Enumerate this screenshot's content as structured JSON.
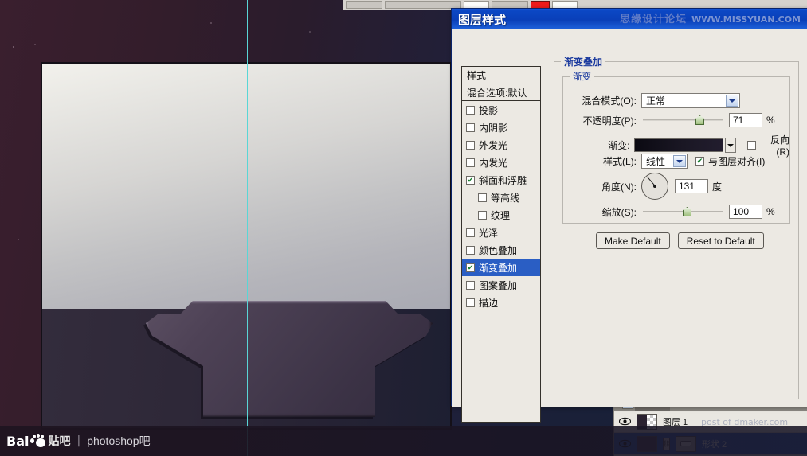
{
  "dialog": {
    "title": "图层样式",
    "styles_panel": {
      "header": "样式",
      "blending_options": "混合选项:默认",
      "items": [
        {
          "label": "投影",
          "checked": false,
          "indent": false,
          "active": false
        },
        {
          "label": "内阴影",
          "checked": false,
          "indent": false,
          "active": false
        },
        {
          "label": "外发光",
          "checked": false,
          "indent": false,
          "active": false
        },
        {
          "label": "内发光",
          "checked": false,
          "indent": false,
          "active": false
        },
        {
          "label": "斜面和浮雕",
          "checked": true,
          "indent": false,
          "active": false
        },
        {
          "label": "等高线",
          "checked": false,
          "indent": true,
          "active": false
        },
        {
          "label": "纹理",
          "checked": false,
          "indent": true,
          "active": false
        },
        {
          "label": "光泽",
          "checked": false,
          "indent": false,
          "active": false
        },
        {
          "label": "颜色叠加",
          "checked": false,
          "indent": false,
          "active": false
        },
        {
          "label": "渐变叠加",
          "checked": true,
          "indent": false,
          "active": true
        },
        {
          "label": "图案叠加",
          "checked": false,
          "indent": false,
          "active": false
        },
        {
          "label": "描边",
          "checked": false,
          "indent": false,
          "active": false
        }
      ]
    },
    "panel": {
      "group_title": "渐变叠加",
      "subgroup_title": "渐变",
      "blend_mode": {
        "label": "混合模式(O):",
        "value": "正常"
      },
      "opacity": {
        "label": "不透明度(P):",
        "value": "71",
        "unit": "%",
        "slider_pct": 71
      },
      "gradient": {
        "label": "渐变:",
        "start_color": "#0b0a12",
        "end_color": "#221d2e"
      },
      "reverse": {
        "label": "反向(R)",
        "checked": false
      },
      "style": {
        "label": "样式(L):",
        "value": "线性"
      },
      "align_layer": {
        "label": "与图层对齐(I)",
        "checked": true
      },
      "angle": {
        "label": "角度(N):",
        "value": "131",
        "unit": "度"
      },
      "scale": {
        "label": "缩放(S):",
        "value": "100",
        "unit": "%",
        "slider_pct": 50
      },
      "make_default": "Make Default",
      "reset_default": "Reset to Default"
    }
  },
  "layers_panel": {
    "rows": [
      {
        "name": "图层 1",
        "thumb": "checker",
        "selected": false,
        "has_mask": false
      },
      {
        "name": "形状 2",
        "thumb": "solid",
        "selected": true,
        "has_mask": true
      }
    ]
  },
  "watermarks": {
    "top_text": "思缘设计论坛",
    "top_url": "WWW.MISSYUAN.COM",
    "layers_overlay": "post of dmaker.com",
    "baidu": "Bai",
    "baidu_tieba": "贴吧",
    "separator": "|",
    "forum": "photoshop吧"
  },
  "canvas": {
    "guide_color": "#59d6d6",
    "doc_top_gradient_from": "#f2f1ec",
    "doc_top_gradient_to": "#a9aab3",
    "shape_color": "#443a4d"
  }
}
